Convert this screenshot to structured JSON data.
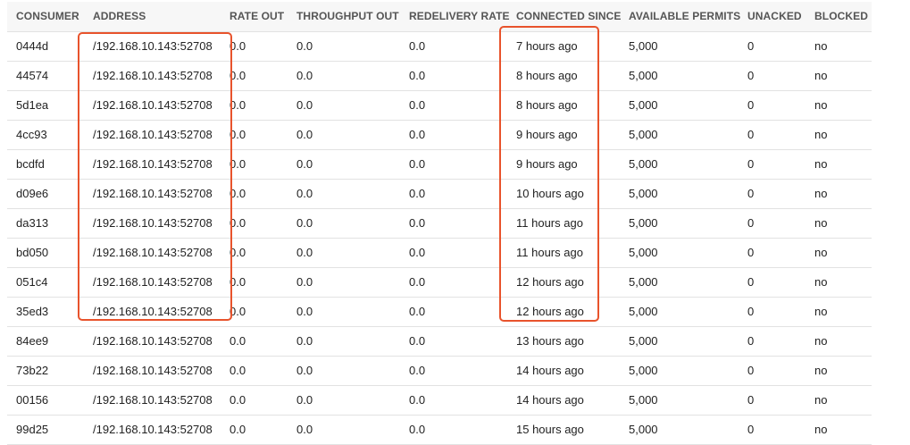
{
  "table": {
    "headers": {
      "consumer": "CONSUMER",
      "address": "ADDRESS",
      "rate_out": "RATE OUT",
      "throughput_out": "THROUGHPUT OUT",
      "redelivery_rate": "REDELIVERY RATE",
      "connected_since": "CONNECTED SINCE",
      "available_permits": "AVAILABLE PERMITS",
      "unacked": "UNACKED",
      "blocked": "BLOCKED"
    },
    "rows": [
      {
        "consumer": "0444d",
        "address": "/192.168.10.143:52708",
        "rate_out": "0.0",
        "throughput_out": "0.0",
        "redelivery_rate": "0.0",
        "connected_since": "7 hours ago",
        "available_permits": "5,000",
        "unacked": "0",
        "blocked": "no"
      },
      {
        "consumer": "44574",
        "address": "/192.168.10.143:52708",
        "rate_out": "0.0",
        "throughput_out": "0.0",
        "redelivery_rate": "0.0",
        "connected_since": "8 hours ago",
        "available_permits": "5,000",
        "unacked": "0",
        "blocked": "no"
      },
      {
        "consumer": "5d1ea",
        "address": "/192.168.10.143:52708",
        "rate_out": "0.0",
        "throughput_out": "0.0",
        "redelivery_rate": "0.0",
        "connected_since": "8 hours ago",
        "available_permits": "5,000",
        "unacked": "0",
        "blocked": "no"
      },
      {
        "consumer": "4cc93",
        "address": "/192.168.10.143:52708",
        "rate_out": "0.0",
        "throughput_out": "0.0",
        "redelivery_rate": "0.0",
        "connected_since": "9 hours ago",
        "available_permits": "5,000",
        "unacked": "0",
        "blocked": "no"
      },
      {
        "consumer": "bcdfd",
        "address": "/192.168.10.143:52708",
        "rate_out": "0.0",
        "throughput_out": "0.0",
        "redelivery_rate": "0.0",
        "connected_since": "9 hours ago",
        "available_permits": "5,000",
        "unacked": "0",
        "blocked": "no"
      },
      {
        "consumer": "d09e6",
        "address": "/192.168.10.143:52708",
        "rate_out": "0.0",
        "throughput_out": "0.0",
        "redelivery_rate": "0.0",
        "connected_since": "10 hours ago",
        "available_permits": "5,000",
        "unacked": "0",
        "blocked": "no"
      },
      {
        "consumer": "da313",
        "address": "/192.168.10.143:52708",
        "rate_out": "0.0",
        "throughput_out": "0.0",
        "redelivery_rate": "0.0",
        "connected_since": "11 hours ago",
        "available_permits": "5,000",
        "unacked": "0",
        "blocked": "no"
      },
      {
        "consumer": "bd050",
        "address": "/192.168.10.143:52708",
        "rate_out": "0.0",
        "throughput_out": "0.0",
        "redelivery_rate": "0.0",
        "connected_since": "11 hours ago",
        "available_permits": "5,000",
        "unacked": "0",
        "blocked": "no"
      },
      {
        "consumer": "051c4",
        "address": "/192.168.10.143:52708",
        "rate_out": "0.0",
        "throughput_out": "0.0",
        "redelivery_rate": "0.0",
        "connected_since": "12 hours ago",
        "available_permits": "5,000",
        "unacked": "0",
        "blocked": "no"
      },
      {
        "consumer": "35ed3",
        "address": "/192.168.10.143:52708",
        "rate_out": "0.0",
        "throughput_out": "0.0",
        "redelivery_rate": "0.0",
        "connected_since": "12 hours ago",
        "available_permits": "5,000",
        "unacked": "0",
        "blocked": "no"
      },
      {
        "consumer": "84ee9",
        "address": "/192.168.10.143:52708",
        "rate_out": "0.0",
        "throughput_out": "0.0",
        "redelivery_rate": "0.0",
        "connected_since": "13 hours ago",
        "available_permits": "5,000",
        "unacked": "0",
        "blocked": "no"
      },
      {
        "consumer": "73b22",
        "address": "/192.168.10.143:52708",
        "rate_out": "0.0",
        "throughput_out": "0.0",
        "redelivery_rate": "0.0",
        "connected_since": "14 hours ago",
        "available_permits": "5,000",
        "unacked": "0",
        "blocked": "no"
      },
      {
        "consumer": "00156",
        "address": "/192.168.10.143:52708",
        "rate_out": "0.0",
        "throughput_out": "0.0",
        "redelivery_rate": "0.0",
        "connected_since": "14 hours ago",
        "available_permits": "5,000",
        "unacked": "0",
        "blocked": "no"
      },
      {
        "consumer": "99d25",
        "address": "/192.168.10.143:52708",
        "rate_out": "0.0",
        "throughput_out": "0.0",
        "redelivery_rate": "0.0",
        "connected_since": "15 hours ago",
        "available_permits": "5,000",
        "unacked": "0",
        "blocked": "no"
      }
    ]
  },
  "annotations": {
    "highlight_color": "#e8532c"
  }
}
